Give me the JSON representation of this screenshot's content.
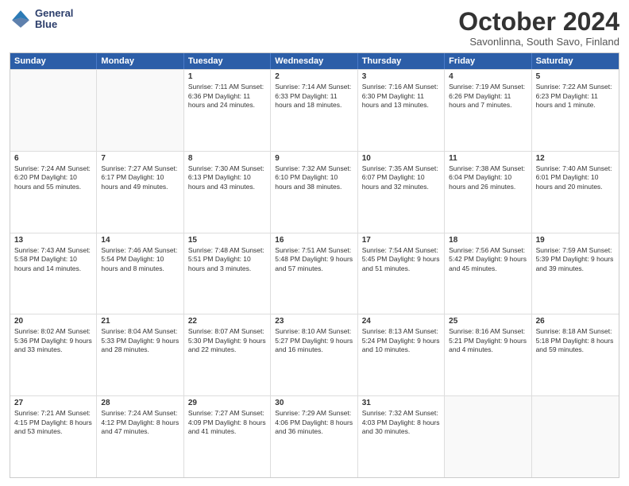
{
  "logo": {
    "line1": "General",
    "line2": "Blue"
  },
  "title": "October 2024",
  "subtitle": "Savonlinna, South Savo, Finland",
  "header_days": [
    "Sunday",
    "Monday",
    "Tuesday",
    "Wednesday",
    "Thursday",
    "Friday",
    "Saturday"
  ],
  "weeks": [
    [
      {
        "day": "",
        "info": "",
        "empty": true
      },
      {
        "day": "",
        "info": "",
        "empty": true
      },
      {
        "day": "1",
        "info": "Sunrise: 7:11 AM\nSunset: 6:36 PM\nDaylight: 11 hours and 24 minutes."
      },
      {
        "day": "2",
        "info": "Sunrise: 7:14 AM\nSunset: 6:33 PM\nDaylight: 11 hours and 18 minutes."
      },
      {
        "day": "3",
        "info": "Sunrise: 7:16 AM\nSunset: 6:30 PM\nDaylight: 11 hours and 13 minutes."
      },
      {
        "day": "4",
        "info": "Sunrise: 7:19 AM\nSunset: 6:26 PM\nDaylight: 11 hours and 7 minutes."
      },
      {
        "day": "5",
        "info": "Sunrise: 7:22 AM\nSunset: 6:23 PM\nDaylight: 11 hours and 1 minute."
      }
    ],
    [
      {
        "day": "6",
        "info": "Sunrise: 7:24 AM\nSunset: 6:20 PM\nDaylight: 10 hours and 55 minutes."
      },
      {
        "day": "7",
        "info": "Sunrise: 7:27 AM\nSunset: 6:17 PM\nDaylight: 10 hours and 49 minutes."
      },
      {
        "day": "8",
        "info": "Sunrise: 7:30 AM\nSunset: 6:13 PM\nDaylight: 10 hours and 43 minutes."
      },
      {
        "day": "9",
        "info": "Sunrise: 7:32 AM\nSunset: 6:10 PM\nDaylight: 10 hours and 38 minutes."
      },
      {
        "day": "10",
        "info": "Sunrise: 7:35 AM\nSunset: 6:07 PM\nDaylight: 10 hours and 32 minutes."
      },
      {
        "day": "11",
        "info": "Sunrise: 7:38 AM\nSunset: 6:04 PM\nDaylight: 10 hours and 26 minutes."
      },
      {
        "day": "12",
        "info": "Sunrise: 7:40 AM\nSunset: 6:01 PM\nDaylight: 10 hours and 20 minutes."
      }
    ],
    [
      {
        "day": "13",
        "info": "Sunrise: 7:43 AM\nSunset: 5:58 PM\nDaylight: 10 hours and 14 minutes."
      },
      {
        "day": "14",
        "info": "Sunrise: 7:46 AM\nSunset: 5:54 PM\nDaylight: 10 hours and 8 minutes."
      },
      {
        "day": "15",
        "info": "Sunrise: 7:48 AM\nSunset: 5:51 PM\nDaylight: 10 hours and 3 minutes."
      },
      {
        "day": "16",
        "info": "Sunrise: 7:51 AM\nSunset: 5:48 PM\nDaylight: 9 hours and 57 minutes."
      },
      {
        "day": "17",
        "info": "Sunrise: 7:54 AM\nSunset: 5:45 PM\nDaylight: 9 hours and 51 minutes."
      },
      {
        "day": "18",
        "info": "Sunrise: 7:56 AM\nSunset: 5:42 PM\nDaylight: 9 hours and 45 minutes."
      },
      {
        "day": "19",
        "info": "Sunrise: 7:59 AM\nSunset: 5:39 PM\nDaylight: 9 hours and 39 minutes."
      }
    ],
    [
      {
        "day": "20",
        "info": "Sunrise: 8:02 AM\nSunset: 5:36 PM\nDaylight: 9 hours and 33 minutes."
      },
      {
        "day": "21",
        "info": "Sunrise: 8:04 AM\nSunset: 5:33 PM\nDaylight: 9 hours and 28 minutes."
      },
      {
        "day": "22",
        "info": "Sunrise: 8:07 AM\nSunset: 5:30 PM\nDaylight: 9 hours and 22 minutes."
      },
      {
        "day": "23",
        "info": "Sunrise: 8:10 AM\nSunset: 5:27 PM\nDaylight: 9 hours and 16 minutes."
      },
      {
        "day": "24",
        "info": "Sunrise: 8:13 AM\nSunset: 5:24 PM\nDaylight: 9 hours and 10 minutes."
      },
      {
        "day": "25",
        "info": "Sunrise: 8:16 AM\nSunset: 5:21 PM\nDaylight: 9 hours and 4 minutes."
      },
      {
        "day": "26",
        "info": "Sunrise: 8:18 AM\nSunset: 5:18 PM\nDaylight: 8 hours and 59 minutes."
      }
    ],
    [
      {
        "day": "27",
        "info": "Sunrise: 7:21 AM\nSunset: 4:15 PM\nDaylight: 8 hours and 53 minutes."
      },
      {
        "day": "28",
        "info": "Sunrise: 7:24 AM\nSunset: 4:12 PM\nDaylight: 8 hours and 47 minutes."
      },
      {
        "day": "29",
        "info": "Sunrise: 7:27 AM\nSunset: 4:09 PM\nDaylight: 8 hours and 41 minutes."
      },
      {
        "day": "30",
        "info": "Sunrise: 7:29 AM\nSunset: 4:06 PM\nDaylight: 8 hours and 36 minutes."
      },
      {
        "day": "31",
        "info": "Sunrise: 7:32 AM\nSunset: 4:03 PM\nDaylight: 8 hours and 30 minutes."
      },
      {
        "day": "",
        "info": "",
        "empty": true
      },
      {
        "day": "",
        "info": "",
        "empty": true
      }
    ]
  ]
}
